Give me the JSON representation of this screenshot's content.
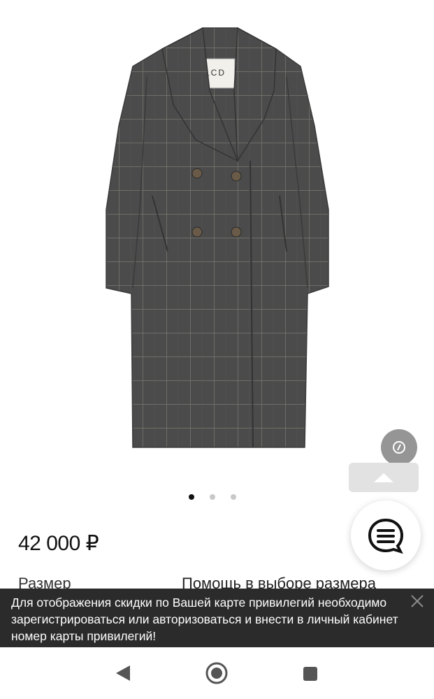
{
  "product": {
    "image_alt": "coat",
    "carousel": {
      "count": 3,
      "active_index": 0
    },
    "price": "42 000 ₽",
    "size_label": "Размер",
    "size_help": "Помощь в выборе размера"
  },
  "notice": {
    "text": "Для отображения скидки по Вашей карте привилегий необходимо зарегистрироваться или авторизоваться и внести в личный кабинет номер карты привилегий!"
  },
  "icons": {
    "compass": "compass-icon",
    "scroll_top": "arrow-up-icon",
    "chat": "chat-icon",
    "close": "close-icon",
    "back": "back-icon",
    "home": "home-icon",
    "recents": "recents-icon"
  },
  "colors": {
    "coat": "#4a4a4a",
    "notice_bg": "#2b2b2b",
    "dot_active": "#111111",
    "dot_inactive": "#c8c8c8"
  }
}
